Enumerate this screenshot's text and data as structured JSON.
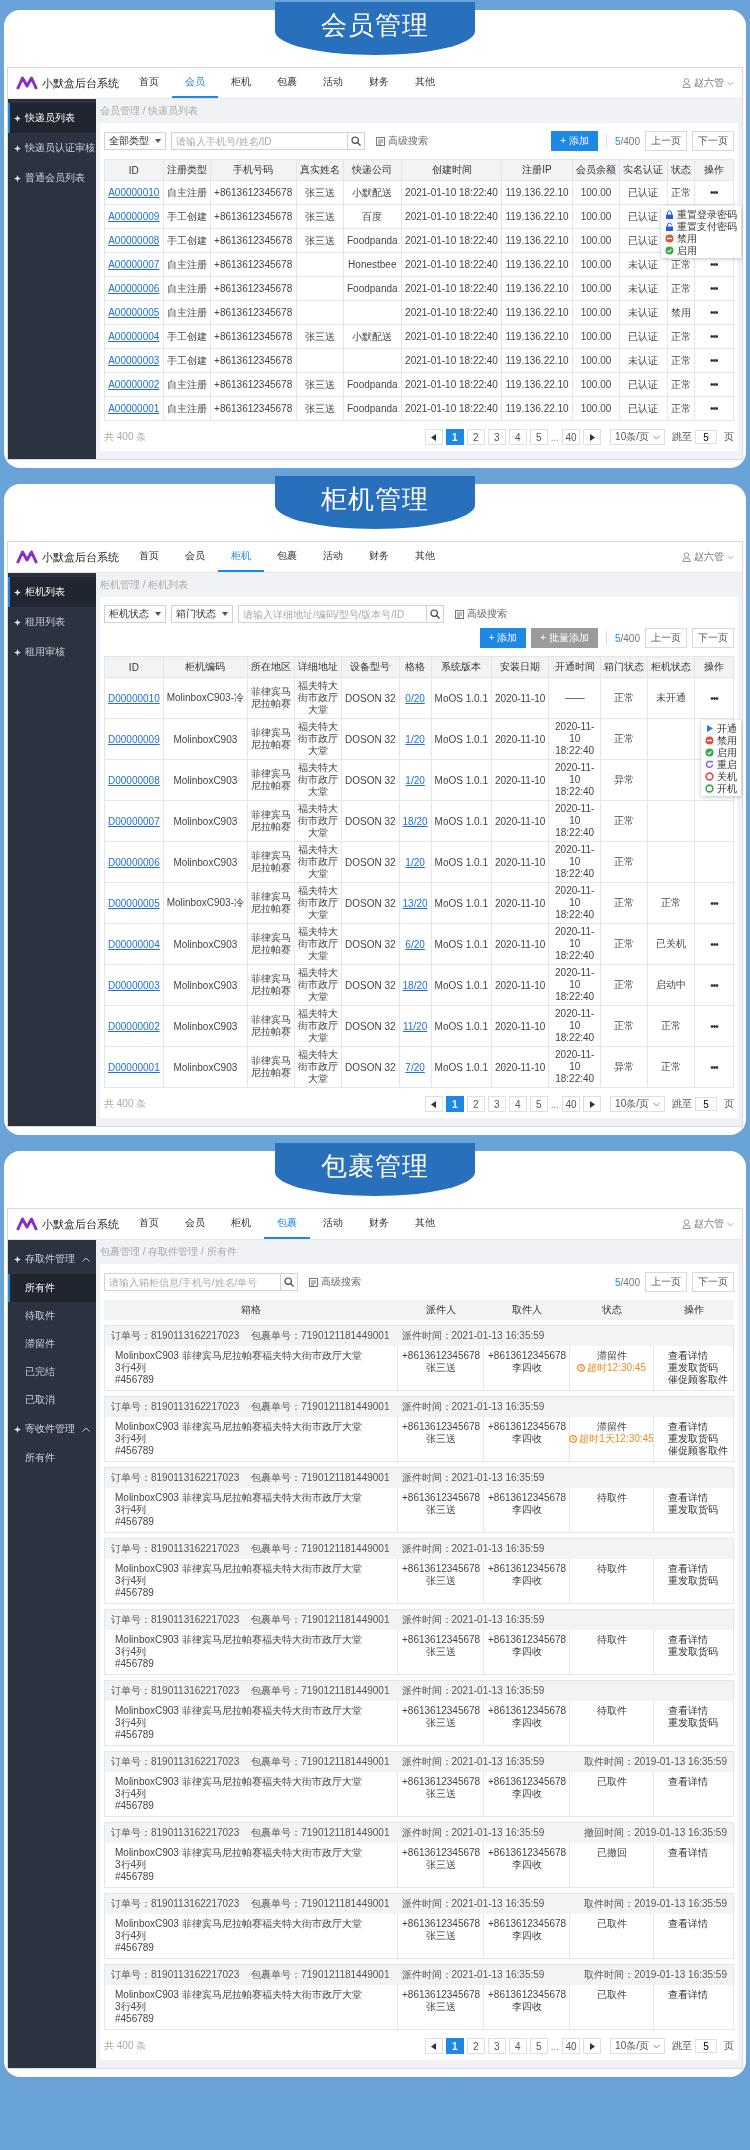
{
  "sections": [
    {
      "title": "会员管理",
      "screen": {
        "app_name": "小默盒后台系统",
        "nav": [
          {
            "label": "首页",
            "selected": false
          },
          {
            "label": "会员",
            "selected": true
          },
          {
            "label": "柜机",
            "selected": false
          },
          {
            "label": "包裹",
            "selected": false
          },
          {
            "label": "活动",
            "selected": false
          },
          {
            "label": "财务",
            "selected": false
          },
          {
            "label": "其他",
            "selected": false
          }
        ],
        "user": "赵六管",
        "sidebar": [
          {
            "label": "快递员列表",
            "selected": true
          },
          {
            "label": "快递员认证审核",
            "selected": false
          },
          {
            "label": "普通会员列表",
            "selected": false
          }
        ],
        "breadcrumb": "会员管理 / 快递员列表",
        "filters": [
          {
            "kind": "select",
            "value": "全部类型"
          },
          {
            "kind": "search",
            "placeholder": "请输入手机号/姓名/ID"
          }
        ],
        "advanced_search": "高级搜索",
        "buttons": [
          {
            "label": "+ 添加",
            "kind": "primary"
          }
        ],
        "counter": {
          "current": "5",
          "total": "/400"
        },
        "prev": "上一页",
        "next": "下一页",
        "table": {
          "kind": "grid",
          "columns": [
            {
              "label": "ID",
              "kind": "link"
            },
            {
              "label": "注册类型",
              "kind": "text"
            },
            {
              "label": "手机号码",
              "kind": "text"
            },
            {
              "label": "真实姓名",
              "kind": "text"
            },
            {
              "label": "快递公司",
              "kind": "text"
            },
            {
              "label": "创建时间",
              "kind": "text"
            },
            {
              "label": "注册IP",
              "kind": "text"
            },
            {
              "label": "会员余额",
              "kind": "text"
            },
            {
              "label": "实名认证",
              "kind": "text"
            },
            {
              "label": "状态",
              "kind": "text"
            },
            {
              "label": "操作",
              "kind": "more"
            }
          ],
          "rows": [
            {
              "cells": [
                "A00000010",
                "自主注册",
                "+8613612345678",
                "张三送",
                "小默配送",
                "2021-01-10 18:22:40",
                "119.136.22.10",
                "100.00",
                "已认证",
                "正常",
                "•••"
              ]
            },
            {
              "cells": [
                "A00000009",
                "手工创建",
                "+8613612345678",
                "张三送",
                "百度",
                "2021-01-10 18:22:40",
                "119.136.22.10",
                "100.00",
                "已认证",
                null,
                null
              ],
              "menu": [
                {
                  "label": "重置登录密码",
                  "kind": "lock"
                },
                {
                  "label": "重置支付密码",
                  "kind": "unlock"
                },
                {
                  "label": "禁用",
                  "kind": "ban"
                },
                {
                  "label": "启用",
                  "kind": "check"
                }
              ]
            },
            {
              "cells": [
                "A00000008",
                "手工创建",
                "+8613612345678",
                "张三送",
                "Foodpanda",
                "2021-01-10 18:22:40",
                "119.136.22.10",
                "100.00",
                "已认证",
                null,
                null
              ]
            },
            {
              "cells": [
                "A00000007",
                "自主注册",
                "+8613612345678",
                null,
                "Honestbee",
                "2021-01-10 18:22:40",
                "119.136.22.10",
                "100.00",
                "未认证",
                "正常",
                "•••"
              ]
            },
            {
              "cells": [
                "A00000006",
                "自主注册",
                "+8613612345678",
                null,
                "Foodpanda",
                "2021-01-10 18:22:40",
                "119.136.22.10",
                "100.00",
                "未认证",
                "正常",
                "•••"
              ]
            },
            {
              "cells": [
                "A00000005",
                "自主注册",
                "+8613612345678",
                null,
                null,
                "2021-01-10 18:22:40",
                "119.136.22.10",
                "100.00",
                "未认证",
                "禁用",
                "•••"
              ]
            },
            {
              "cells": [
                "A00000004",
                "手工创建",
                "+8613612345678",
                "张三送",
                "小默配送",
                "2021-01-10 18:22:40",
                "119.136.22.10",
                "100.00",
                "已认证",
                "正常",
                "•••"
              ]
            },
            {
              "cells": [
                "A00000003",
                "手工创建",
                "+8613612345678",
                null,
                null,
                "2021-01-10 18:22:40",
                "119.136.22.10",
                "100.00",
                "未认证",
                "正常",
                "•••"
              ]
            },
            {
              "cells": [
                "A00000002",
                "自主注册",
                "+8613612345678",
                "张三送",
                "Foodpanda",
                "2021-01-10 18:22:40",
                "119.136.22.10",
                "100.00",
                "已认证",
                "正常",
                "•••"
              ]
            },
            {
              "cells": [
                "A00000001",
                "自主注册",
                "+8613612345678",
                "张三送",
                "Foodpanda",
                "2021-01-10 18:22:40",
                "119.136.22.10",
                "100.00",
                "已认证",
                "正常",
                "•••"
              ]
            }
          ]
        },
        "pagination": {
          "total": "共 400 条",
          "pages": [
            {
              "label": "1",
              "kind": "page",
              "selected": true
            },
            {
              "label": "2",
              "kind": "page",
              "selected": false
            },
            {
              "label": "3",
              "kind": "page",
              "selected": false
            },
            {
              "label": "4",
              "kind": "page",
              "selected": false
            },
            {
              "label": "5",
              "kind": "page",
              "selected": false
            },
            {
              "label": "...",
              "kind": "ellipsis"
            },
            {
              "label": "40",
              "kind": "page",
              "selected": false
            }
          ],
          "page_size": "10条/页",
          "jump_label": "跳至",
          "jump_value": "5",
          "jump_unit": "页"
        }
      }
    },
    {
      "title": "柜机管理",
      "screen": {
        "app_name": "小默盒后台系统",
        "nav": [
          {
            "label": "首页",
            "selected": false
          },
          {
            "label": "会员",
            "selected": false
          },
          {
            "label": "柜机",
            "selected": true
          },
          {
            "label": "包裹",
            "selected": false
          },
          {
            "label": "活动",
            "selected": false
          },
          {
            "label": "财务",
            "selected": false
          },
          {
            "label": "其他",
            "selected": false
          }
        ],
        "user": "赵六管",
        "sidebar": [
          {
            "label": "柜机列表",
            "selected": true
          },
          {
            "label": "租用列表",
            "selected": false
          },
          {
            "label": "租用审核",
            "selected": false
          }
        ],
        "breadcrumb": "柜机管理 / 柜机列表",
        "filters": [
          {
            "kind": "select",
            "value": "柜机状态"
          },
          {
            "kind": "select",
            "value": "箱门状态"
          },
          {
            "kind": "search",
            "placeholder": "请输入详细地址/编码/型号/版本号/ID"
          }
        ],
        "advanced_search": "高级搜索",
        "buttons": [
          {
            "label": "+ 添加",
            "kind": "primary"
          },
          {
            "label": "+ 批量添加",
            "kind": "secondary"
          }
        ],
        "counter": {
          "current": "5",
          "total": "/400"
        },
        "prev": "上一页",
        "next": "下一页",
        "table": {
          "kind": "grid",
          "columns": [
            {
              "label": "ID",
              "kind": "link"
            },
            {
              "label": "柜机编码",
              "kind": "text"
            },
            {
              "label": "所在地区",
              "kind": "address"
            },
            {
              "label": "详细地址",
              "kind": "address"
            },
            {
              "label": "设备型号",
              "kind": "text"
            },
            {
              "label": "格格",
              "kind": "link"
            },
            {
              "label": "系统版本",
              "kind": "text"
            },
            {
              "label": "安装日期",
              "kind": "text"
            },
            {
              "label": "开通时间",
              "kind": "datetime"
            },
            {
              "label": "箱门状态",
              "kind": "text"
            },
            {
              "label": "柜机状态",
              "kind": "text"
            },
            {
              "label": "操作",
              "kind": "more"
            }
          ],
          "rows": [
            {
              "cells": [
                "D00000010",
                "MolinboxC903-冷",
                "菲律宾马尼拉帕赛",
                "福夫特大街市政厅大堂",
                "DOSON 32",
                "0/20",
                "MoOS 1.0.1",
                "2020-11-10",
                "——",
                "正常",
                "未开通",
                "•••"
              ]
            },
            {
              "cells": [
                "D00000009",
                "MolinboxC903",
                "菲律宾马尼拉帕赛",
                "福夫特大街市政厅大堂",
                "DOSON 32",
                "1/20",
                "MoOS 1.0.1",
                "2020-11-10",
                "2020-11-10 18:22:40",
                "正常",
                null,
                null
              ],
              "menu": [
                {
                  "label": "开通",
                  "kind": "play"
                },
                {
                  "label": "禁用",
                  "kind": "ban"
                },
                {
                  "label": "启用",
                  "kind": "check"
                },
                {
                  "label": "重启",
                  "kind": "restart"
                },
                {
                  "label": "关机",
                  "kind": "power_off"
                },
                {
                  "label": "开机",
                  "kind": "power_on"
                }
              ]
            },
            {
              "cells": [
                "D00000008",
                "MolinboxC903",
                "菲律宾马尼拉帕赛",
                "福夫特大街市政厅大堂",
                "DOSON 32",
                "1/20",
                "MoOS 1.0.1",
                "2020-11-10",
                "2020-11-10 18:22:40",
                "异常",
                null,
                null
              ]
            },
            {
              "cells": [
                "D00000007",
                "MolinboxC903",
                "菲律宾马尼拉帕赛",
                "福夫特大街市政厅大堂",
                "DOSON 32",
                "18/20",
                "MoOS 1.0.1",
                "2020-11-10",
                "2020-11-10 18:22:40",
                "正常",
                null,
                null
              ]
            },
            {
              "cells": [
                "D00000006",
                "MolinboxC903",
                "菲律宾马尼拉帕赛",
                "福夫特大街市政厅大堂",
                "DOSON 32",
                "1/20",
                "MoOS 1.0.1",
                "2020-11-10",
                "2020-11-10 18:22:40",
                "正常",
                null,
                null
              ]
            },
            {
              "cells": [
                "D00000005",
                "MolinboxC903-冷",
                "菲律宾马尼拉帕赛",
                "福夫特大街市政厅大堂",
                "DOSON 32",
                "13/20",
                "MoOS 1.0.1",
                "2020-11-10",
                "2020-11-10 18:22:40",
                "正常",
                "正常",
                "•••"
              ]
            },
            {
              "cells": [
                "D00000004",
                "MolinboxC903",
                "菲律宾马尼拉帕赛",
                "福夫特大街市政厅大堂",
                "DOSON 32",
                "6/20",
                "MoOS 1.0.1",
                "2020-11-10",
                "2020-11-10 18:22:40",
                "正常",
                "已关机",
                "•••"
              ]
            },
            {
              "cells": [
                "D00000003",
                "MolinboxC903",
                "菲律宾马尼拉帕赛",
                "福夫特大街市政厅大堂",
                "DOSON 32",
                "18/20",
                "MoOS 1.0.1",
                "2020-11-10",
                "2020-11-10 18:22:40",
                "正常",
                "启动中",
                "•••"
              ]
            },
            {
              "cells": [
                "D00000002",
                "MolinboxC903",
                "菲律宾马尼拉帕赛",
                "福夫特大街市政厅大堂",
                "DOSON 32",
                "11/20",
                "MoOS 1.0.1",
                "2020-11-10",
                "2020-11-10 18:22:40",
                "正常",
                "正常",
                "•••"
              ]
            },
            {
              "cells": [
                "D00000001",
                "MolinboxC903",
                "菲律宾马尼拉帕赛",
                "福夫特大街市政厅大堂",
                "DOSON 32",
                "7/20",
                "MoOS 1.0.1",
                "2020-11-10",
                "2020-11-10 18:22:40",
                "异常",
                "正常",
                "•••"
              ]
            }
          ]
        },
        "pagination": {
          "total": "共 400 条",
          "pages": [
            {
              "label": "1",
              "kind": "page",
              "selected": true
            },
            {
              "label": "2",
              "kind": "page",
              "selected": false
            },
            {
              "label": "3",
              "kind": "page",
              "selected": false
            },
            {
              "label": "4",
              "kind": "page",
              "selected": false
            },
            {
              "label": "5",
              "kind": "page",
              "selected": false
            },
            {
              "label": "...",
              "kind": "ellipsis"
            },
            {
              "label": "40",
              "kind": "page",
              "selected": false
            }
          ],
          "page_size": "10条/页",
          "jump_label": "跳至",
          "jump_value": "5",
          "jump_unit": "页"
        }
      }
    },
    {
      "title": "包裹管理",
      "screen": {
        "app_name": "小默盒后台系统",
        "nav": [
          {
            "label": "首页",
            "selected": false
          },
          {
            "label": "会员",
            "selected": false
          },
          {
            "label": "柜机",
            "selected": false
          },
          {
            "label": "包裹",
            "selected": true
          },
          {
            "label": "活动",
            "selected": false
          },
          {
            "label": "财务",
            "selected": false
          },
          {
            "label": "其他",
            "selected": false
          }
        ],
        "user": "赵六管",
        "sidebar": [
          {
            "label": "存取件管理",
            "expanded": true,
            "children": [
              {
                "label": "所有件",
                "selected": true
              },
              {
                "label": "待取件",
                "selected": false
              },
              {
                "label": "滞留件",
                "selected": false
              },
              {
                "label": "已完结",
                "selected": false
              },
              {
                "label": "已取消",
                "selected": false
              }
            ]
          },
          {
            "label": "寄收件管理",
            "expanded": true,
            "children": [
              {
                "label": "所有件",
                "selected": false
              }
            ]
          }
        ],
        "breadcrumb": "包裹管理 / 存取件管理 / 所有件",
        "filters": [
          {
            "kind": "search",
            "placeholder": "请输入箱柜信息/手机号/姓名/单号"
          }
        ],
        "advanced_search": "高级搜索",
        "counter": {
          "current": "5",
          "total": "/400"
        },
        "prev": "上一页",
        "next": "下一页",
        "table": {
          "kind": "packages",
          "columns": [
            {
              "label": "箱格"
            },
            {
              "label": "派件人"
            },
            {
              "label": "取件人"
            },
            {
              "label": "状态"
            },
            {
              "label": "操作"
            }
          ],
          "entries": [
            {
              "order": "订单号：8190113162217023",
              "package": "包裹单号：7190121181449001",
              "dispatched": "派件时间：2021-01-13 16:35:59",
              "location": "MolinboxC903 菲律宾马尼拉帕赛福夫特大街市政厅大堂",
              "slot": "3行4列",
              "code": "#456789",
              "sender_phone": "+8613612345678",
              "sender_name": "张三送",
              "receiver_phone": "+8613612345678",
              "receiver_name": "李四收",
              "status": "滞留件",
              "overdue": "超时12:30:45",
              "actions": [
                "查看详情",
                "重发取货码",
                "催促顾客取件"
              ]
            },
            {
              "order": "订单号：8190113162217023",
              "package": "包裹单号：7190121181449001",
              "dispatched": "派件时间：2021-01-13 16:35:59",
              "location": "MolinboxC903 菲律宾马尼拉帕赛福夫特大街市政厅大堂",
              "slot": "3行4列",
              "code": "#456789",
              "sender_phone": "+8613612345678",
              "sender_name": "张三送",
              "receiver_phone": "+8613612345678",
              "receiver_name": "李四收",
              "status": "滞留件",
              "overdue": "超时1天12:30:45",
              "actions": [
                "查看详情",
                "重发取货码",
                "催促顾客取件"
              ]
            },
            {
              "order": "订单号：8190113162217023",
              "package": "包裹单号：7190121181449001",
              "dispatched": "派件时间：2021-01-13 16:35:59",
              "location": "MolinboxC903 菲律宾马尼拉帕赛福夫特大街市政厅大堂",
              "slot": "3行4列",
              "code": "#456789",
              "sender_phone": "+8613612345678",
              "sender_name": "张三送",
              "receiver_phone": "+8613612345678",
              "receiver_name": "李四收",
              "status": "待取件",
              "actions": [
                "查看详情",
                "重发取货码"
              ]
            },
            {
              "order": "订单号：8190113162217023",
              "package": "包裹单号：7190121181449001",
              "dispatched": "派件时间：2021-01-13 16:35:59",
              "location": "MolinboxC903 菲律宾马尼拉帕赛福夫特大街市政厅大堂",
              "slot": "3行4列",
              "code": "#456789",
              "sender_phone": "+8613612345678",
              "sender_name": "张三送",
              "receiver_phone": "+8613612345678",
              "receiver_name": "李四收",
              "status": "待取件",
              "actions": [
                "查看详情",
                "重发取货码"
              ]
            },
            {
              "order": "订单号：8190113162217023",
              "package": "包裹单号：7190121181449001",
              "dispatched": "派件时间：2021-01-13 16:35:59",
              "location": "MolinboxC903 菲律宾马尼拉帕赛福夫特大街市政厅大堂",
              "slot": "3行4列",
              "code": "#456789",
              "sender_phone": "+8613612345678",
              "sender_name": "张三送",
              "receiver_phone": "+8613612345678",
              "receiver_name": "李四收",
              "status": "待取件",
              "actions": [
                "查看详情",
                "重发取货码"
              ]
            },
            {
              "order": "订单号：8190113162217023",
              "package": "包裹单号：7190121181449001",
              "dispatched": "派件时间：2021-01-13 16:35:59",
              "location": "MolinboxC903 菲律宾马尼拉帕赛福夫特大街市政厅大堂",
              "slot": "3行4列",
              "code": "#456789",
              "sender_phone": "+8613612345678",
              "sender_name": "张三送",
              "receiver_phone": "+8613612345678",
              "receiver_name": "李四收",
              "status": "待取件",
              "actions": [
                "查看详情",
                "重发取货码"
              ]
            },
            {
              "order": "订单号：8190113162217023",
              "package": "包裹单号：7190121181449001",
              "dispatched": "派件时间：2021-01-13 16:35:59",
              "closed": "取件时间：2019-01-13 16:35:59",
              "location": "MolinboxC903 菲律宾马尼拉帕赛福夫特大街市政厅大堂",
              "slot": "3行4列",
              "code": "#456789",
              "sender_phone": "+8613612345678",
              "sender_name": "张三送",
              "receiver_phone": "+8613612345678",
              "receiver_name": "李四收",
              "status": "已取件",
              "actions": [
                "查看详情"
              ]
            },
            {
              "order": "订单号：8190113162217023",
              "package": "包裹单号：7190121181449001",
              "dispatched": "派件时间：2021-01-13 16:35:59",
              "closed": "撤回时间：2019-01-13 16:35:59",
              "location": "MolinboxC903 菲律宾马尼拉帕赛福夫特大街市政厅大堂",
              "slot": "3行4列",
              "code": "#456789",
              "sender_phone": "+8613612345678",
              "sender_name": "张三送",
              "receiver_phone": "+8613612345678",
              "receiver_name": "李四收",
              "status": "已撤回",
              "actions": [
                "查看详情"
              ]
            },
            {
              "order": "订单号：8190113162217023",
              "package": "包裹单号：7190121181449001",
              "dispatched": "派件时间：2021-01-13 16:35:59",
              "closed": "取件时间：2019-01-13 16:35:59",
              "location": "MolinboxC903 菲律宾马尼拉帕赛福夫特大街市政厅大堂",
              "slot": "3行4列",
              "code": "#456789",
              "sender_phone": "+8613612345678",
              "sender_name": "张三送",
              "receiver_phone": "+8613612345678",
              "receiver_name": "李四收",
              "status": "已取件",
              "actions": [
                "查看详情"
              ]
            },
            {
              "order": "订单号：8190113162217023",
              "package": "包裹单号：7190121181449001",
              "dispatched": "派件时间：2021-01-13 16:35:59",
              "closed": "取件时间：2019-01-13 16:35:59",
              "location": "MolinboxC903 菲律宾马尼拉帕赛福夫特大街市政厅大堂",
              "slot": "3行4列",
              "code": "#456789",
              "sender_phone": "+8613612345678",
              "sender_name": "张三送",
              "receiver_phone": "+8613612345678",
              "receiver_name": "李四收",
              "status": "已取件",
              "actions": [
                "查看详情"
              ]
            }
          ]
        },
        "pagination": {
          "total": "共 400 条",
          "pages": [
            {
              "label": "1",
              "kind": "page",
              "selected": true
            },
            {
              "label": "2",
              "kind": "page",
              "selected": false
            },
            {
              "label": "3",
              "kind": "page",
              "selected": false
            },
            {
              "label": "4",
              "kind": "page",
              "selected": false
            },
            {
              "label": "5",
              "kind": "page",
              "selected": false
            },
            {
              "label": "...",
              "kind": "ellipsis"
            },
            {
              "label": "40",
              "kind": "page",
              "selected": false
            }
          ],
          "page_size": "10条/页",
          "jump_label": "跳至",
          "jump_value": "5",
          "jump_unit": "页"
        }
      }
    }
  ]
}
